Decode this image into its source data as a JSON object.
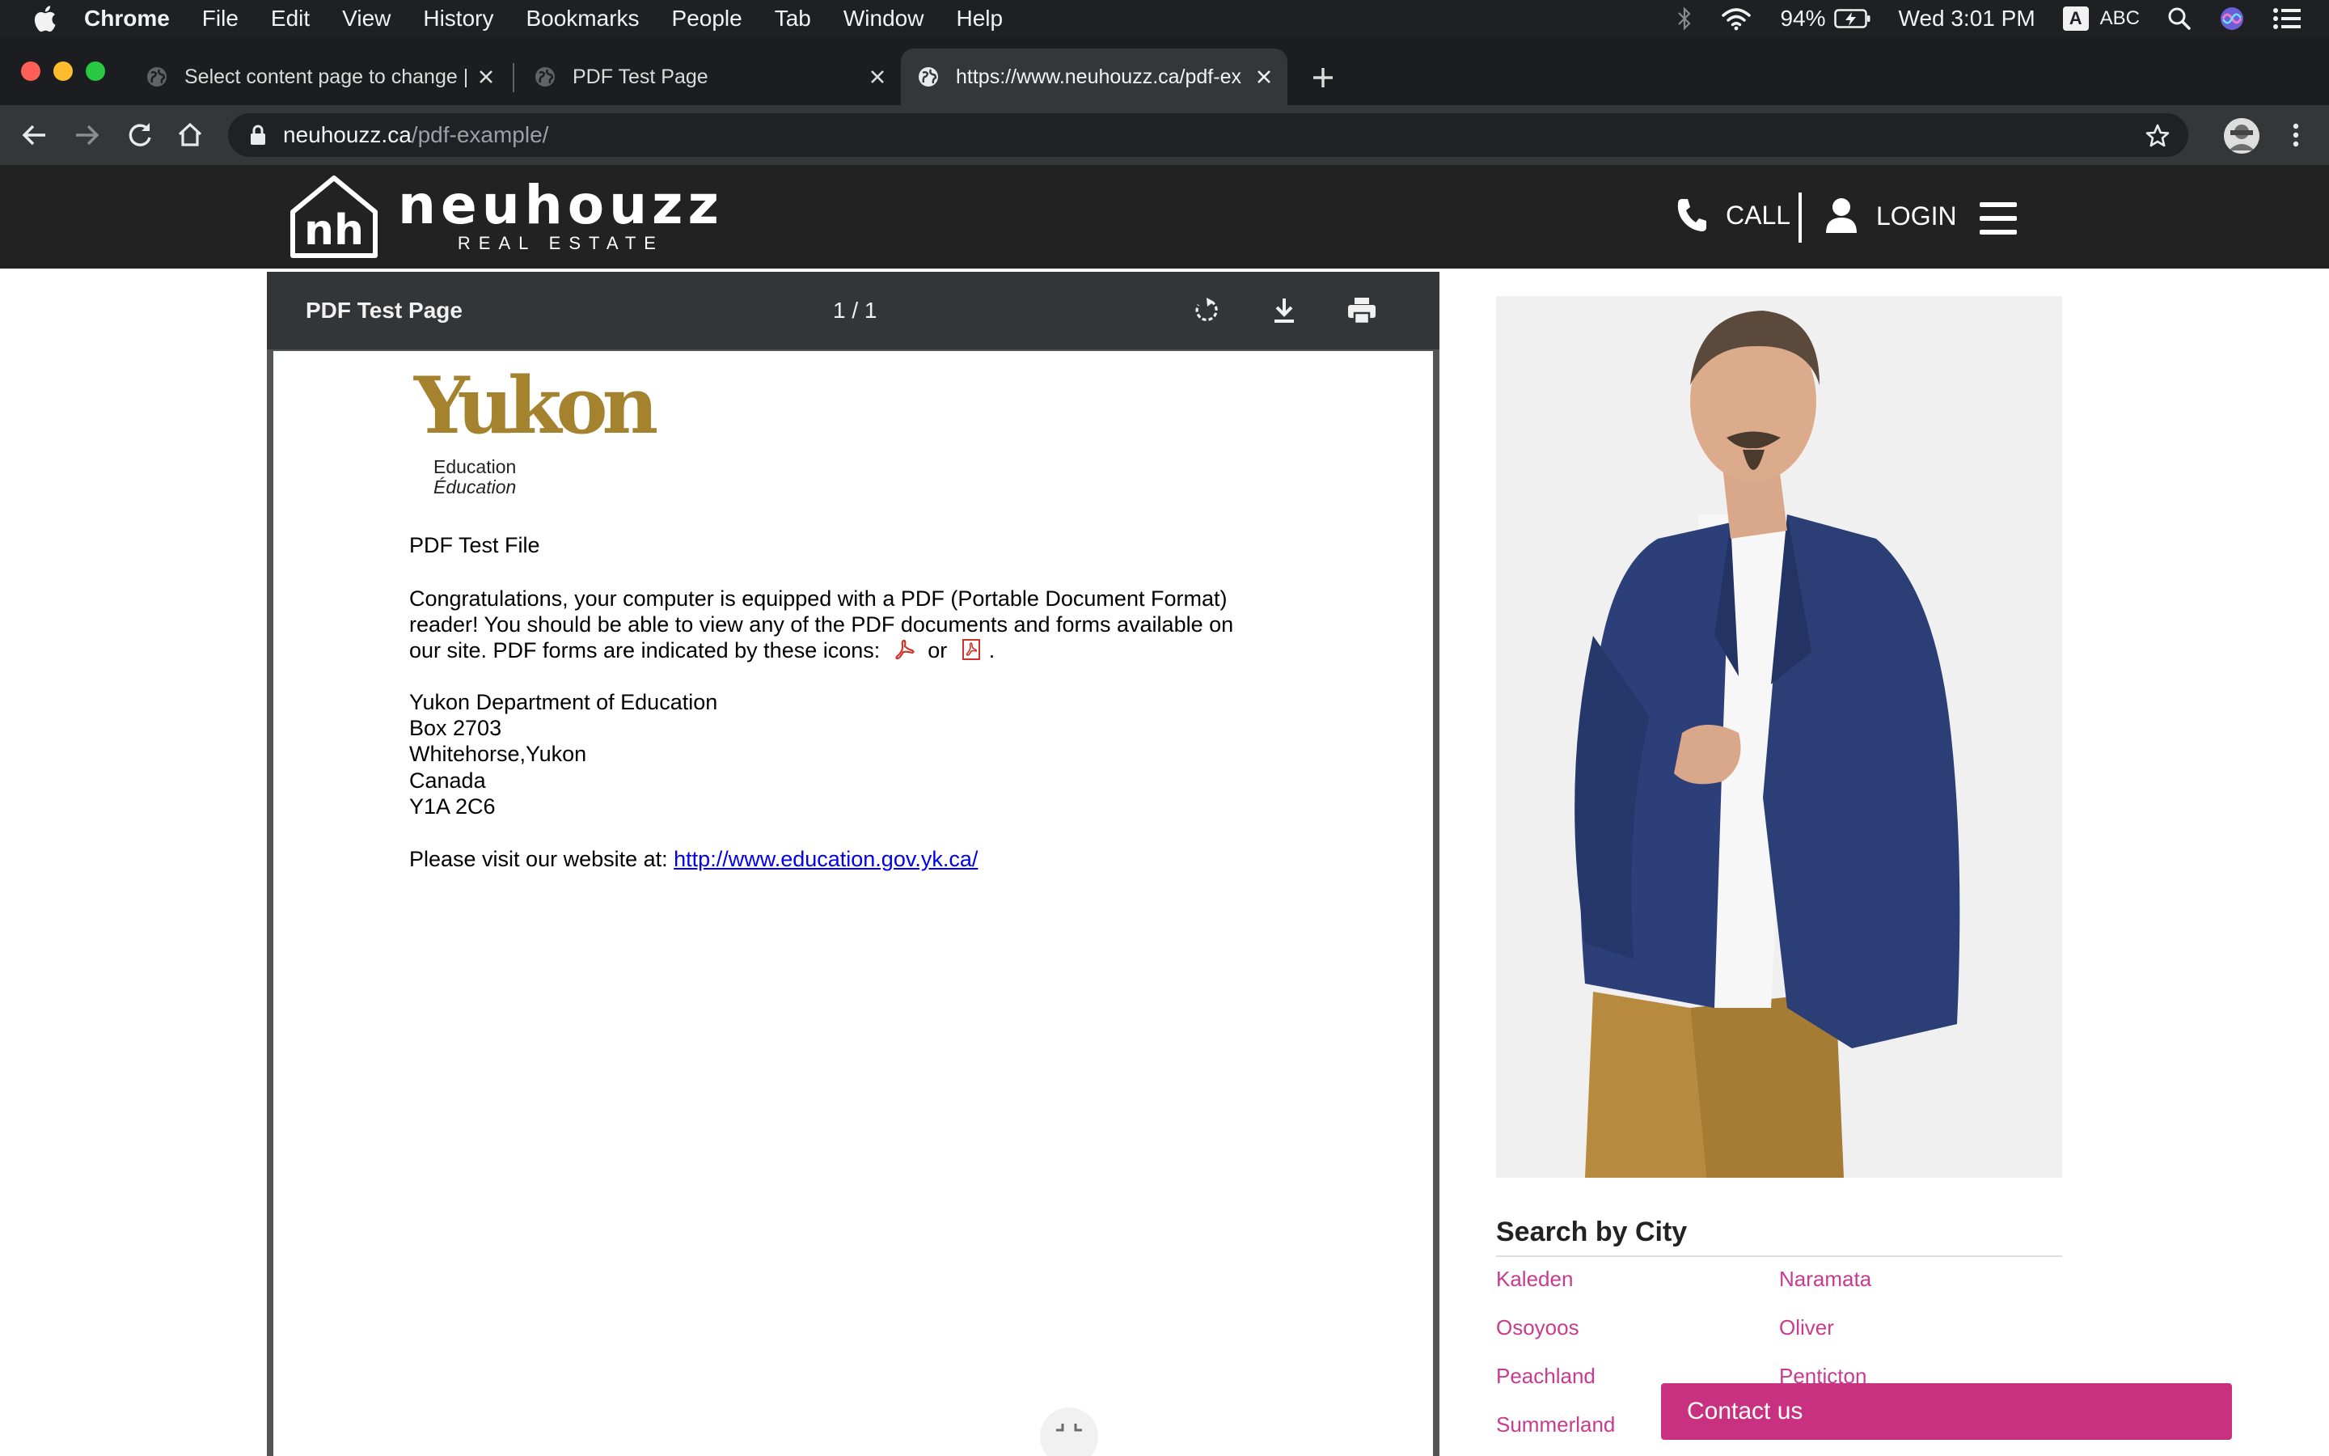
{
  "menubar": {
    "app_name": "Chrome",
    "menus": [
      "File",
      "Edit",
      "View",
      "History",
      "Bookmarks",
      "People",
      "Tab",
      "Window",
      "Help"
    ],
    "battery": "94%",
    "clock": "Wed 3:01 PM",
    "input_source_badge": "A",
    "input_source": "ABC"
  },
  "tabs": [
    {
      "title": "Select content page to change |",
      "active": false
    },
    {
      "title": "PDF Test Page",
      "active": false
    },
    {
      "title": "https://www.neuhouzz.ca/pdf-ex",
      "active": true
    }
  ],
  "omnibox": {
    "host": "neuhouzz.ca",
    "path": "/pdf-example/"
  },
  "site": {
    "logo_mark": "nh",
    "logo_name": "neuhouzz",
    "logo_subtitle": "REAL ESTATE",
    "call_label": "CALL",
    "login_label": "LOGIN"
  },
  "pdf": {
    "toolbar_title": "PDF Test Page",
    "page_indicator": "1 / 1",
    "logo_word": "Yukon",
    "logo_line1": "Education",
    "logo_line2": "Éducation",
    "heading": "PDF Test File",
    "para_line1": "Congratulations, your computer is equipped with a PDF (Portable Document Format)",
    "para_line2": "reader!  You should be able to view any of the PDF documents and forms available on",
    "para_line3a": "our site.  PDF forms are indicated by these icons: ",
    "para_line3b": " or ",
    "para_line3c": ".",
    "address": [
      "Yukon Department of Education",
      "Box 2703",
      "Whitehorse,Yukon",
      "Canada",
      "Y1A 2C6"
    ],
    "visit_text": "Please visit our website at:  ",
    "visit_link": "http://www.education.gov.yk.ca/"
  },
  "sidebar": {
    "search_title": "Search by City",
    "cities": [
      "Kaleden",
      "Naramata",
      "Osoyoos",
      "Oliver",
      "Peachland",
      "Penticton",
      "Summerland"
    ],
    "contact_label": "Contact us"
  },
  "colors": {
    "accent_pink": "#c8317f",
    "city_link": "#c83b8d",
    "yukon_gold": "#a4822e",
    "header_bg": "#222222"
  }
}
